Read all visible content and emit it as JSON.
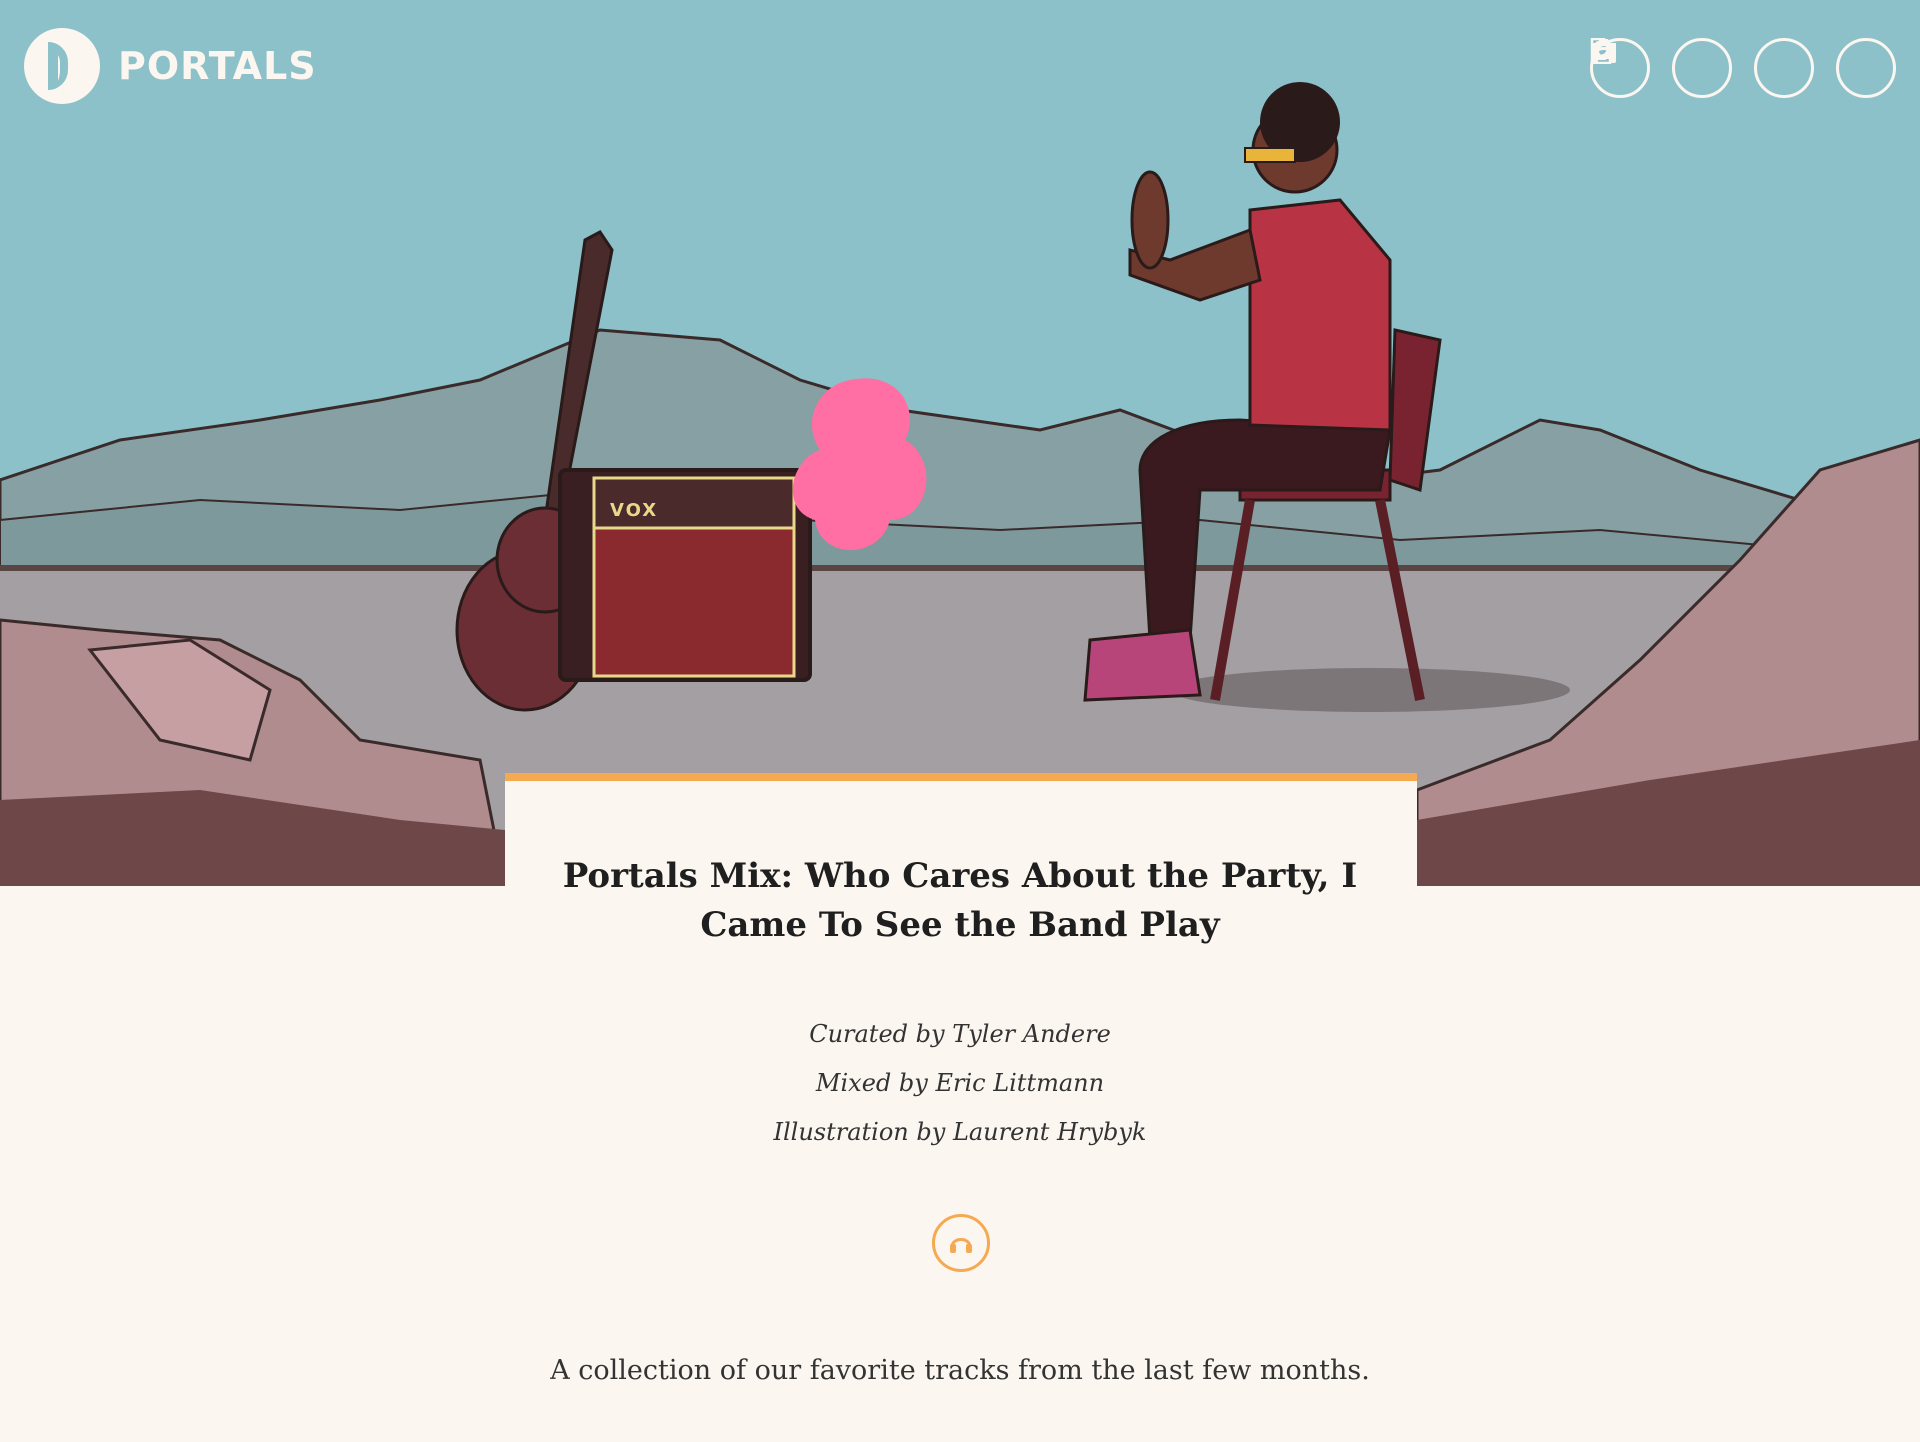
{
  "brand": {
    "name": "PORTALS"
  },
  "header_icons": [
    {
      "name": "document-icon",
      "glyph": "☰"
    },
    {
      "name": "camera-icon",
      "glyph": "◉"
    },
    {
      "name": "headphones-icon",
      "glyph": "∩"
    },
    {
      "name": "search-icon",
      "glyph": "⚲"
    }
  ],
  "hero": {
    "amp_label": "VOX"
  },
  "article": {
    "title": "Portals Mix: Who Cares About the Party, I Came To See the Band Play",
    "credits": [
      "Curated by Tyler Andere",
      "Mixed by Eric Littmann",
      "Illustration by Laurent Hrybyk"
    ],
    "description": "A collection of our favorite tracks from the last few months."
  },
  "colors": {
    "accent": "#f5a951",
    "sky": "#8cc1ca",
    "background": "#fcf6f0"
  }
}
